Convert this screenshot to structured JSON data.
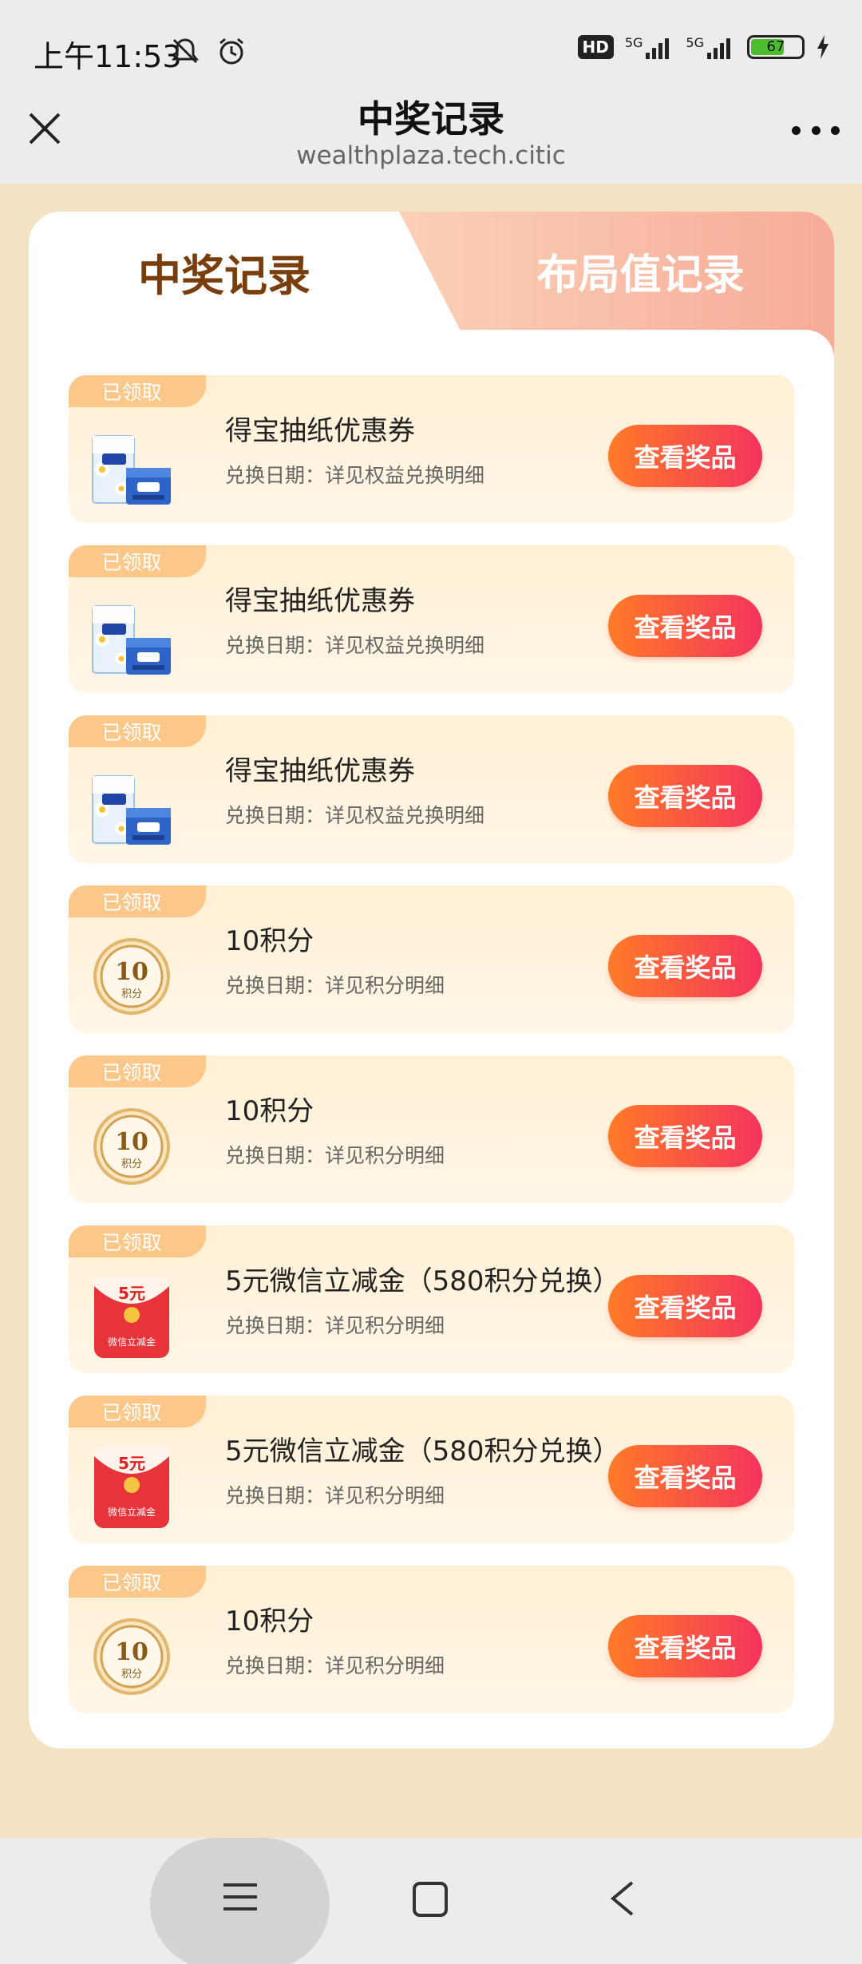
{
  "status_bar": {
    "time": "上午11:53",
    "hd_label": "HD",
    "signal1_label": "5G",
    "signal2_label": "5G",
    "battery": "67"
  },
  "header": {
    "title": "中奖记录",
    "url": "wealthplaza.tech.citic"
  },
  "tabs": {
    "active": "中奖记录",
    "inactive": "布局值记录"
  },
  "records": [
    {
      "badge": "已领取",
      "title": "得宝抽纸优惠券",
      "date": "兑换日期：详见权益兑换明细",
      "button": "查看奖品",
      "thumb": "tissue"
    },
    {
      "badge": "已领取",
      "title": "得宝抽纸优惠券",
      "date": "兑换日期：详见权益兑换明细",
      "button": "查看奖品",
      "thumb": "tissue"
    },
    {
      "badge": "已领取",
      "title": "得宝抽纸优惠券",
      "date": "兑换日期：详见权益兑换明细",
      "button": "查看奖品",
      "thumb": "tissue"
    },
    {
      "badge": "已领取",
      "title": "10积分",
      "date": "兑换日期：详见积分明细",
      "button": "查看奖品",
      "thumb": "coin"
    },
    {
      "badge": "已领取",
      "title": "10积分",
      "date": "兑换日期：详见积分明细",
      "button": "查看奖品",
      "thumb": "coin"
    },
    {
      "badge": "已领取",
      "title": "5元微信立减金（580积分兑换）",
      "date": "兑换日期：详见积分明细",
      "button": "查看奖品",
      "thumb": "redpacket"
    },
    {
      "badge": "已领取",
      "title": "5元微信立减金（580积分兑换）",
      "date": "兑换日期：详见积分明细",
      "button": "查看奖品",
      "thumb": "redpacket"
    },
    {
      "badge": "已领取",
      "title": "10积分",
      "date": "兑换日期：详见积分明细",
      "button": "查看奖品",
      "thumb": "coin"
    }
  ],
  "thumb_text": {
    "coin_value": "10",
    "coin_label": "积分",
    "redpacket_value": "5元",
    "redpacket_label": "微信立减金"
  },
  "icons": {
    "close": "close-icon",
    "more": "more-icon",
    "nav_menu": "menu-icon",
    "nav_home": "home-square-icon",
    "nav_back": "back-icon"
  },
  "colors": {
    "page_bg": "#f3e3c4",
    "active_tab_text": "#7a3e0c",
    "button_start": "#ff7b27",
    "button_end": "#f5345d",
    "badge_bg": "#fbc88a"
  }
}
